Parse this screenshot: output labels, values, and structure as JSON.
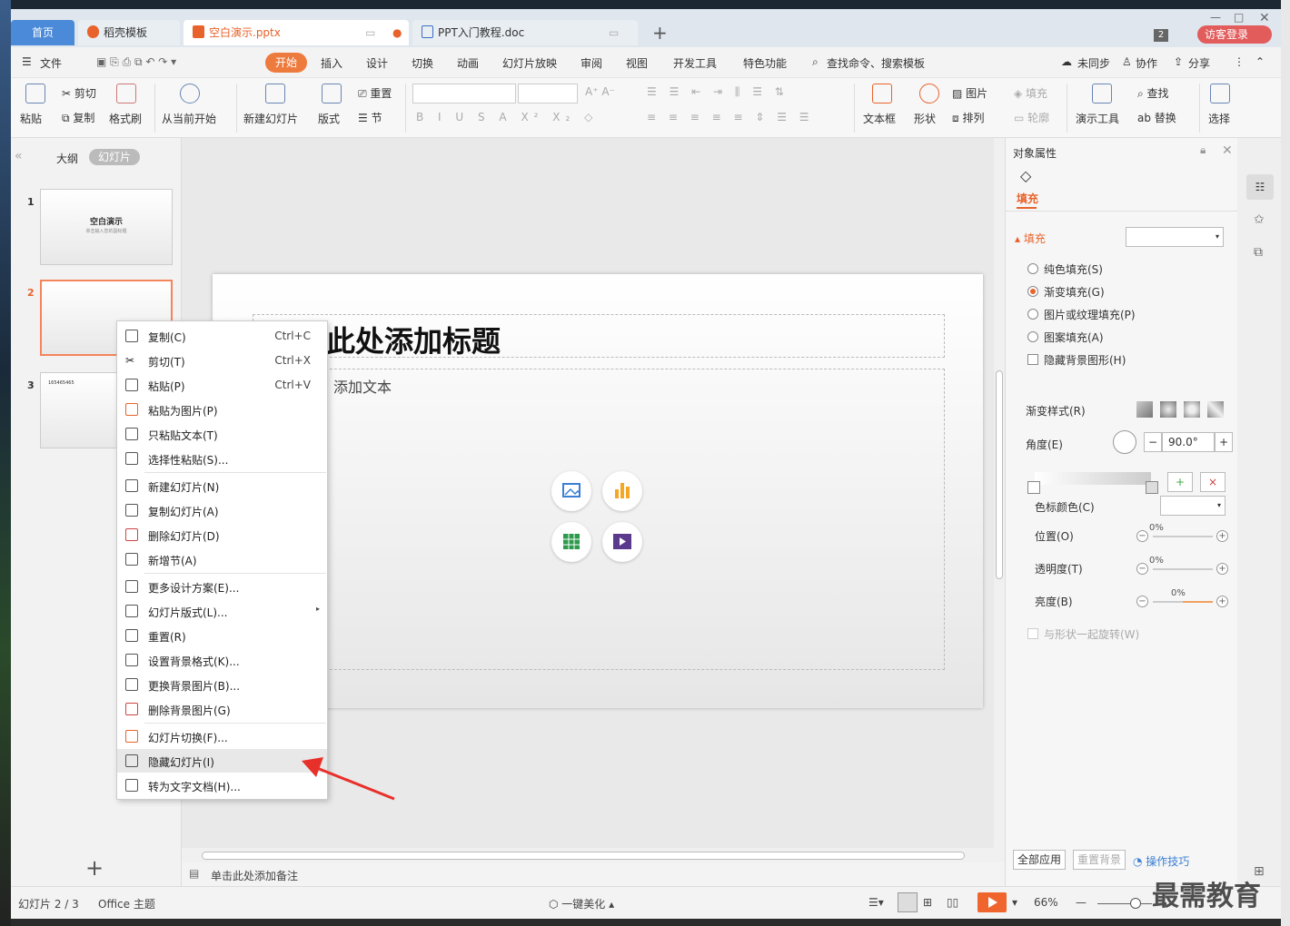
{
  "tabs": {
    "home": "首页",
    "template": "稻壳模板",
    "ppt": "空白演示.pptx",
    "doc": "PPT入门教程.doc",
    "count": "2",
    "login": "访客登录"
  },
  "menu": {
    "file": "文件",
    "start": "开始",
    "insert": "插入",
    "design": "设计",
    "switch": "切换",
    "anim": "动画",
    "show": "幻灯片放映",
    "review": "审阅",
    "view": "视图",
    "dev": "开发工具",
    "special": "特色功能",
    "search": "查找命令、搜索模板",
    "sync": "未同步",
    "collab": "协作",
    "share": "分享"
  },
  "ribbon": {
    "paste": "粘贴",
    "cut": "剪切",
    "copy": "复制",
    "brush": "格式刷",
    "from_start": "从当前开始",
    "new_slide": "新建幻灯片",
    "layout": "版式",
    "reset": "重置",
    "section": "节",
    "textbox": "文本框",
    "shape": "形状",
    "picture": "图片",
    "arrange": "排列",
    "fill": "填充",
    "outline": "轮廓",
    "present": "演示工具",
    "find": "查找",
    "replace": "替换",
    "select": "选择"
  },
  "left": {
    "outline": "大纲",
    "slides": "幻灯片",
    "nums": [
      "1",
      "2",
      "3"
    ],
    "t1_title": "空白演示",
    "t1_sub": "单击输入您的副标题",
    "t3_text": "165465465"
  },
  "slide": {
    "title": "此处添加标题",
    "body": "添加文本"
  },
  "notes": "单击此处添加备注",
  "context": [
    {
      "label": "复制(C)",
      "key": "Ctrl+C"
    },
    {
      "label": "剪切(T)",
      "key": "Ctrl+X"
    },
    {
      "label": "粘贴(P)",
      "key": "Ctrl+V"
    },
    {
      "label": "粘贴为图片(P)",
      "key": ""
    },
    {
      "label": "只粘贴文本(T)",
      "key": ""
    },
    {
      "label": "选择性粘贴(S)...",
      "key": ""
    },
    {
      "label": "新建幻灯片(N)",
      "key": ""
    },
    {
      "label": "复制幻灯片(A)",
      "key": ""
    },
    {
      "label": "删除幻灯片(D)",
      "key": ""
    },
    {
      "label": "新增节(A)",
      "key": ""
    },
    {
      "label": "更多设计方案(E)...",
      "key": ""
    },
    {
      "label": "幻灯片版式(L)...",
      "key": ""
    },
    {
      "label": "重置(R)",
      "key": ""
    },
    {
      "label": "设置背景格式(K)...",
      "key": ""
    },
    {
      "label": "更换背景图片(B)...",
      "key": ""
    },
    {
      "label": "删除背景图片(G)",
      "key": ""
    },
    {
      "label": "幻灯片切换(F)...",
      "key": ""
    },
    {
      "label": "隐藏幻灯片(I)",
      "key": ""
    },
    {
      "label": "转为文字文档(H)...",
      "key": ""
    }
  ],
  "props": {
    "header": "对象属性",
    "fill_tab": "填充",
    "fill_section": "填充",
    "solid": "纯色填充(S)",
    "gradient": "渐变填充(G)",
    "picture": "图片或纹理填充(P)",
    "pattern": "图案填充(A)",
    "hide_bg": "隐藏背景图形(H)",
    "grad_style": "渐变样式(R)",
    "angle": "角度(E)",
    "angle_val": "90.0°",
    "stop_color": "色标颜色(C)",
    "position": "位置(O)",
    "transparency": "透明度(T)",
    "brightness": "亮度(B)",
    "pos_val": "0%",
    "trans_val": "0%",
    "bright_val": "0%",
    "rotate": "与形状一起旋转(W)",
    "apply_all": "全部应用",
    "reset_bg": "重置背景",
    "tips": "操作技巧"
  },
  "status": {
    "slide": "幻灯片 2 / 3",
    "theme": "Office 主题",
    "beautify": "一键美化",
    "zoom": "66%"
  },
  "watermark": "最需教育"
}
